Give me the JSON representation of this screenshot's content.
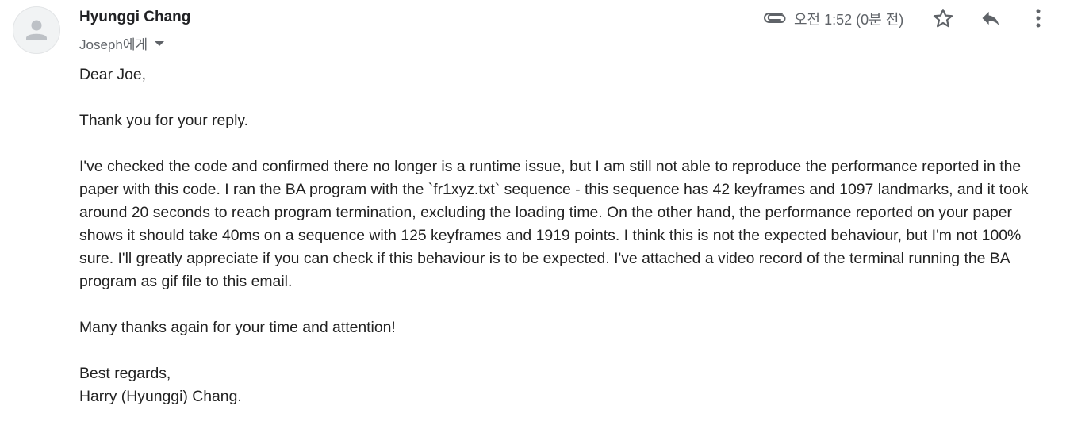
{
  "header": {
    "sender_name": "Hyunggi Chang",
    "recipient": "Joseph에게",
    "timestamp": "오전 1:52 (0분 전)",
    "icons": {
      "avatar": "person-icon",
      "attachment": "paperclip-icon",
      "star": "star-icon",
      "reply": "reply-icon",
      "more": "more-vert-icon",
      "recipient_caret": "caret-down-icon"
    }
  },
  "message": {
    "greeting": "Dear Joe,",
    "paragraphs": [
      "Thank you for your reply.",
      "I've checked the code and confirmed there no longer is a runtime issue, but I am still not able to reproduce the performance reported in the paper with this code. I ran the BA program with the `fr1xyz.txt` sequence - this sequence has 42 keyframes and 1097 landmarks, and it took around 20 seconds to reach program termination, excluding the loading time. On the other hand, the performance reported on your paper shows it should take 40ms on a sequence with 125 keyframes and 1919 points. I think this is not the expected behaviour, but I'm not 100% sure. I'll greatly appreciate if you can check if this behaviour is to be expected. I've attached a video record of the terminal running the BA program as gif file to this email.",
      "Many thanks again for your time and attention!"
    ],
    "closing": "Best regards,",
    "signature": "Harry (Hyunggi) Chang."
  },
  "colors": {
    "text": "#222222",
    "secondary": "#5f6368",
    "avatar_bg": "#f1f3f4",
    "avatar_fg": "#bdc1c6"
  }
}
